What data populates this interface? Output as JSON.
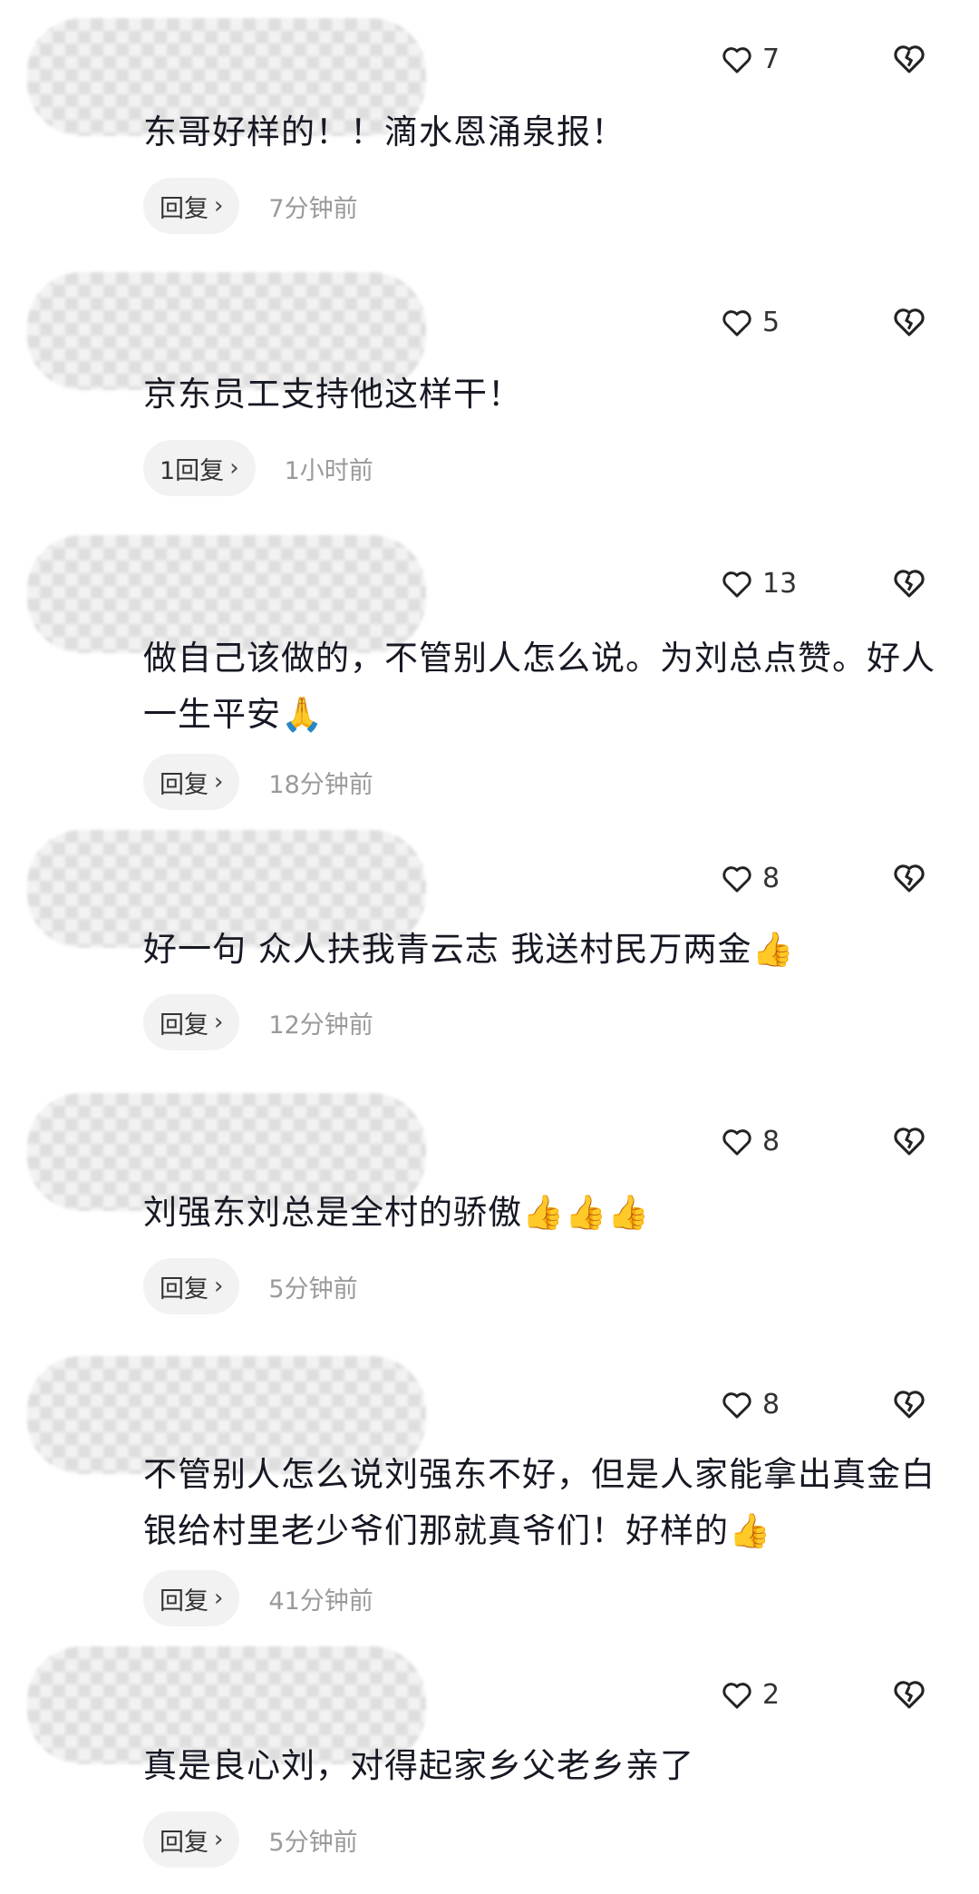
{
  "comments": [
    {
      "likes": "7",
      "text": "东哥好样的！！滴水恩涌泉报！",
      "reply": "回复",
      "time": "7分钟前"
    },
    {
      "likes": "5",
      "text": "京东员工支持他这样干！",
      "reply": "1回复",
      "time": "1小时前"
    },
    {
      "likes": "13",
      "text": "做自己该做的，不管别人怎么说。为刘总点赞。好人一生平安🙏",
      "reply": "回复",
      "time": "18分钟前"
    },
    {
      "likes": "8",
      "text": "好一句 众人扶我青云志 我送村民万两金👍",
      "reply": "回复",
      "time": "12分钟前"
    },
    {
      "likes": "8",
      "text": "刘强东刘总是全村的骄傲👍👍👍",
      "reply": "回复",
      "time": "5分钟前"
    },
    {
      "likes": "8",
      "text": "不管别人怎么说刘强东不好，但是人家能拿出真金白银给村里老少爷们那就真爷们！好样的👍",
      "reply": "回复",
      "time": "41分钟前"
    },
    {
      "likes": "2",
      "text": "真是良心刘，对得起家乡父老乡亲了",
      "reply": "回复",
      "time": "5分钟前"
    }
  ],
  "icons": {
    "like": "heart-outline-icon",
    "dislike": "broken-heart-icon",
    "reply_chevron": "chevron-right-icon"
  },
  "colors": {
    "text": "#161823",
    "meta": "#9a9a9a",
    "reply_bg": "#f2f2f2"
  }
}
